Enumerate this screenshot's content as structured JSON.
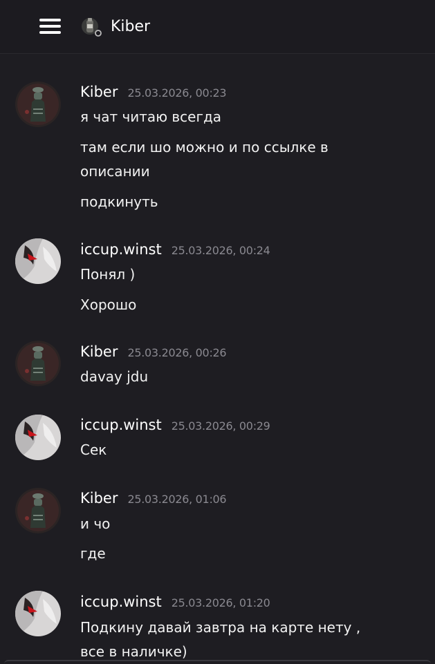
{
  "header": {
    "title": "Kiber",
    "menu_icon": "hamburger-icon",
    "avatar_icon": "bottle-avatar-icon"
  },
  "messages": [
    {
      "author": "Kiber",
      "timestamp": "25.03.2026, 00:23",
      "avatar": "kiber-avatar",
      "lines": [
        "я чат читаю всегда",
        "там если шо можно и по ссылке в",
        "описании",
        "подкинуть"
      ]
    },
    {
      "author": "iccup.winst",
      "timestamp": "25.03.2026, 00:24",
      "avatar": "winst-avatar",
      "lines": [
        "Понял )",
        "Хорошо"
      ]
    },
    {
      "author": "Kiber",
      "timestamp": "25.03.2026, 00:26",
      "avatar": "kiber-avatar",
      "lines": [
        "davay jdu"
      ]
    },
    {
      "author": "iccup.winst",
      "timestamp": "25.03.2026, 00:29",
      "avatar": "winst-avatar",
      "lines": [
        "Сек"
      ]
    },
    {
      "author": "Kiber",
      "timestamp": "25.03.2026, 01:06",
      "avatar": "kiber-avatar",
      "lines": [
        "и чо",
        "где"
      ]
    },
    {
      "author": "iccup.winst",
      "timestamp": "25.03.2026, 01:20",
      "avatar": "winst-avatar",
      "lines": [
        "Подкину давай завтра на карте нету ,",
        "все в наличке)"
      ]
    }
  ],
  "colors": {
    "background": "#1e1d22",
    "text": "#ffffff",
    "timestamp": "#8a8990"
  }
}
